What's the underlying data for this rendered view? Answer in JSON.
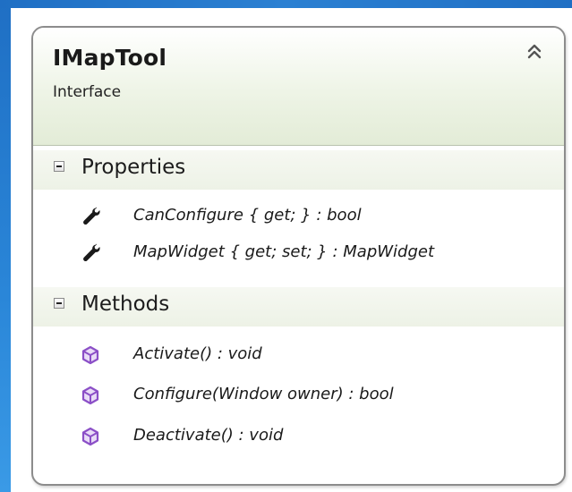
{
  "class": {
    "name": "IMapTool",
    "stereotype": "Interface"
  },
  "sections": {
    "properties": {
      "title": "Properties",
      "items": [
        {
          "text": "CanConfigure { get; } : bool",
          "icon": "wrench-icon"
        },
        {
          "text": "MapWidget { get; set; } : MapWidget",
          "icon": "wrench-icon"
        }
      ]
    },
    "methods": {
      "title": "Methods",
      "items": [
        {
          "text": "Activate() : void",
          "icon": "method-cube-icon"
        },
        {
          "text": "Configure(Window owner) : bool",
          "icon": "method-cube-icon"
        },
        {
          "text": "Deactivate() : void",
          "icon": "method-cube-icon"
        }
      ]
    }
  },
  "colors": {
    "frame_blue": "#1f6fc4",
    "header_green": "#e3ecd7",
    "method_purple": "#8b4fc7",
    "border_gray": "#8c8c8c"
  }
}
